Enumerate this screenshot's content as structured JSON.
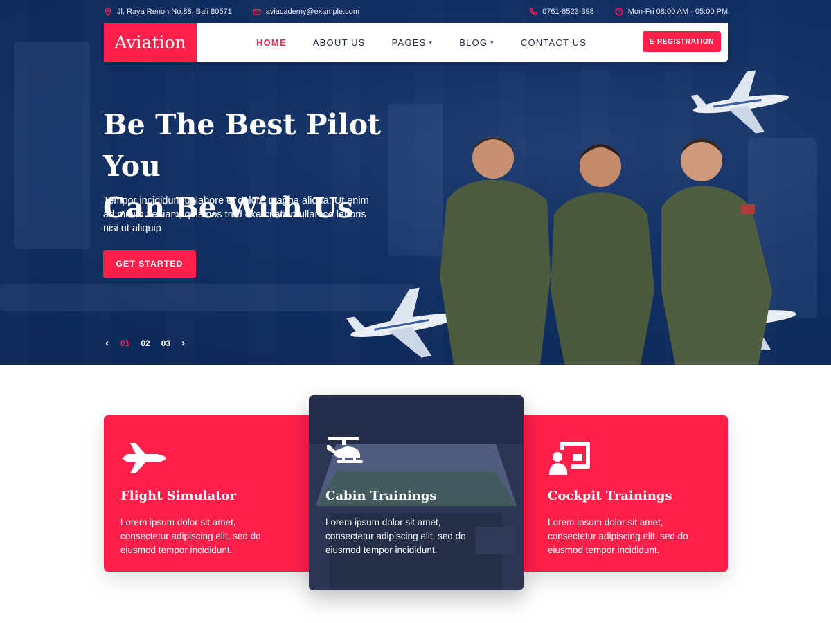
{
  "topbar": {
    "address": "Jl. Raya Renon No.88, Bali 80571",
    "email": "aviacademy@example.com",
    "phone": "0761-8523-398",
    "hours": "Mon-Fri 08:00 AM - 05:00 PM"
  },
  "nav": {
    "logo": "Aviation",
    "links": [
      {
        "label": "HOME",
        "active": true
      },
      {
        "label": "ABOUT US",
        "active": false
      },
      {
        "label": "PAGES",
        "active": false
      },
      {
        "label": "BLOG",
        "active": false
      },
      {
        "label": "CONTACT US",
        "active": false
      }
    ],
    "register_label": "E-REGISTRATION"
  },
  "hero": {
    "title_line1": "Be The Best Pilot You",
    "title_line2": "Can Be With Us",
    "description": "Tempor incididunt ut labore et dolore magna aliqua. Ut enim ad minim veniam, quis nos trud exercitation ullamco laboris nisi ut aliquip",
    "cta_label": "GET STARTED",
    "slides": [
      "01",
      "02",
      "03"
    ],
    "active_slide": "01"
  },
  "services": [
    {
      "title": "Flight Simulator",
      "text": "Lorem ipsum dolor sit amet, consectetur adipiscing elit, sed do eiusmod tempor incididunt.",
      "icon": "fighter-jet-icon"
    },
    {
      "title": "Cabin Trainings",
      "text": "Lorem ipsum dolor sit amet, consectetur adipiscing elit, sed do eiusmod tempor incididunt.",
      "icon": "helicopter-icon"
    },
    {
      "title": "Cockpit Trainings",
      "text": "Lorem ipsum dolor sit amet, consectetur adipiscing elit, sed do eiusmod tempor incididunt.",
      "icon": "presentation-icon"
    }
  ],
  "colors": {
    "accent": "#ff1f4b",
    "hero_bg": "#0e2a5a",
    "text_dark": "#1f2a44"
  }
}
